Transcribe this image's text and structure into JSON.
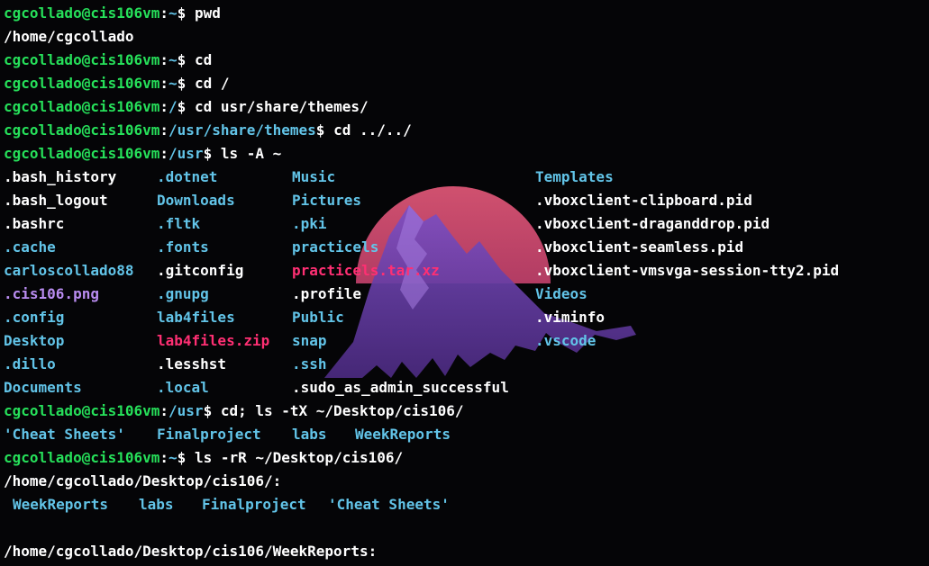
{
  "terminal": {
    "user_host": "cgcollado@cis106vm",
    "colors": {
      "prompt_user": "#26e05a",
      "prompt_path": "#62c4e8",
      "text": "#ffffff",
      "directory": "#62c4e8",
      "image_file": "#b98cf0",
      "archive_file": "#ff2f73",
      "background": "#050507",
      "wallpaper_sun": "#c84a6c",
      "wallpaper_mountain": "#6a3ea8"
    },
    "lines": [
      {
        "type": "prompt",
        "path": "~",
        "command": "pwd"
      },
      {
        "type": "output",
        "text": "/home/cgcollado"
      },
      {
        "type": "prompt",
        "path": "~",
        "command": "cd"
      },
      {
        "type": "prompt",
        "path": "~",
        "command": "cd /"
      },
      {
        "type": "prompt",
        "path": "/",
        "command": "cd usr/share/themes/"
      },
      {
        "type": "prompt",
        "path": "/usr/share/themes",
        "command": "cd ../../"
      },
      {
        "type": "prompt",
        "path": "/usr",
        "command": "ls -A ~"
      }
    ],
    "listing": [
      [
        {
          "name": ".bash_history",
          "kind": "file"
        },
        {
          "name": ".dotnet",
          "kind": "dir"
        },
        {
          "name": "Music",
          "kind": "dir"
        },
        {
          "name": "Templates",
          "kind": "dir"
        }
      ],
      [
        {
          "name": ".bash_logout",
          "kind": "file"
        },
        {
          "name": "Downloads",
          "kind": "dir"
        },
        {
          "name": "Pictures",
          "kind": "dir"
        },
        {
          "name": ".vboxclient-clipboard.pid",
          "kind": "file"
        }
      ],
      [
        {
          "name": ".bashrc",
          "kind": "file"
        },
        {
          "name": ".fltk",
          "kind": "dir"
        },
        {
          "name": ".pki",
          "kind": "dir"
        },
        {
          "name": ".vboxclient-draganddrop.pid",
          "kind": "file"
        }
      ],
      [
        {
          "name": ".cache",
          "kind": "dir"
        },
        {
          "name": ".fonts",
          "kind": "dir"
        },
        {
          "name": "practicels",
          "kind": "dir"
        },
        {
          "name": ".vboxclient-seamless.pid",
          "kind": "file"
        }
      ],
      [
        {
          "name": "carloscollado88",
          "kind": "dir"
        },
        {
          "name": ".gitconfig",
          "kind": "file"
        },
        {
          "name": "practicels.tar.xz",
          "kind": "archive"
        },
        {
          "name": ".vboxclient-vmsvga-session-tty2.pid",
          "kind": "file"
        }
      ],
      [
        {
          "name": ".cis106.png",
          "kind": "image"
        },
        {
          "name": ".gnupg",
          "kind": "dir"
        },
        {
          "name": ".profile",
          "kind": "file"
        },
        {
          "name": "Videos",
          "kind": "dir"
        }
      ],
      [
        {
          "name": ".config",
          "kind": "dir"
        },
        {
          "name": "lab4files",
          "kind": "dir"
        },
        {
          "name": "Public",
          "kind": "dir"
        },
        {
          "name": ".viminfo",
          "kind": "file"
        }
      ],
      [
        {
          "name": "Desktop",
          "kind": "dir"
        },
        {
          "name": "lab4files.zip",
          "kind": "archive"
        },
        {
          "name": "snap",
          "kind": "dir"
        },
        {
          "name": ".vscode",
          "kind": "dir"
        }
      ],
      [
        {
          "name": ".dillo",
          "kind": "dir"
        },
        {
          "name": ".lesshst",
          "kind": "file"
        },
        {
          "name": ".ssh",
          "kind": "dir"
        },
        {
          "name": "",
          "kind": "file"
        }
      ],
      [
        {
          "name": "Documents",
          "kind": "dir"
        },
        {
          "name": ".local",
          "kind": "dir"
        },
        {
          "name": ".sudo_as_admin_successful",
          "kind": "file"
        },
        {
          "name": "",
          "kind": "file"
        }
      ]
    ],
    "after_listing": [
      {
        "type": "prompt",
        "path": "/usr",
        "command": "cd; ls -tX ~/Desktop/cis106/"
      },
      {
        "type": "row4h",
        "items": [
          "'Cheat Sheets'",
          "Finalproject",
          "labs",
          "WeekReports"
        ]
      },
      {
        "type": "prompt",
        "path": "~",
        "command": "ls -rR ~/Desktop/cis106/"
      },
      {
        "type": "output",
        "text": "/home/cgcollado/Desktop/cis106/:"
      },
      {
        "type": "row4r",
        "items": [
          "WeekReports",
          "labs",
          "Finalproject",
          "'Cheat Sheets'"
        ]
      },
      {
        "type": "blank"
      },
      {
        "type": "output",
        "text": "/home/cgcollado/Desktop/cis106/WeekReports:"
      }
    ]
  }
}
